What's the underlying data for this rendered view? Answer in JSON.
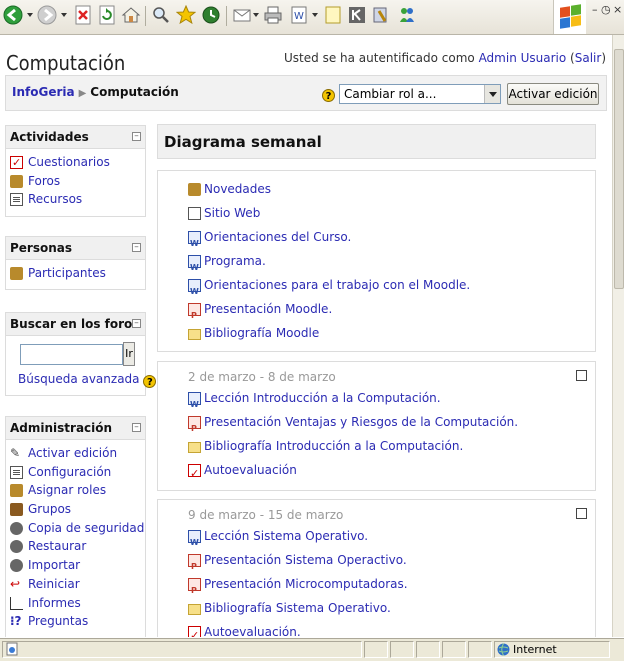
{
  "page": {
    "course_title": "Computación",
    "login_prefix": "Usted se ha autentificado como ",
    "login_user": "Admin Usuario",
    "login_logout": "Salir"
  },
  "navbar": {
    "home": "InfoGeria",
    "separator": "▶",
    "current": "Computación",
    "role_select_value": "Cambiar rol a...",
    "edit_button": "Activar edición"
  },
  "blocks": {
    "actividades": {
      "title": "Actividades",
      "items": [
        "Cuestionarios",
        "Foros",
        "Recursos"
      ]
    },
    "personas": {
      "title": "Personas",
      "items": [
        "Participantes"
      ]
    },
    "buscar": {
      "title": "Buscar en los foros",
      "go_button": "Ir",
      "advanced": "Búsqueda avanzada"
    },
    "administracion": {
      "title": "Administración",
      "items": [
        "Activar edición",
        "Configuración",
        "Asignar roles",
        "Grupos",
        "Copia de seguridad",
        "Restaurar",
        "Importar",
        "Reiniciar",
        "Informes",
        "Preguntas"
      ]
    }
  },
  "main": {
    "title": "Diagrama semanal",
    "section0": [
      "Novedades",
      "Sitio Web",
      "Orientaciones del Curso.",
      "Programa.",
      "Orientaciones para el trabajo con el Moodle.",
      "Presentación Moodle.",
      "Bibliografía Moodle"
    ],
    "week1": {
      "date": "2 de marzo - 8 de marzo",
      "items": [
        "Lección Introducción a la Computación.",
        "Presentación Ventajas y Riesgos de la Computación.",
        "Bibliografía Introducción a la Computación.",
        "Autoevaluación"
      ]
    },
    "week2": {
      "date": "9 de marzo - 15 de marzo",
      "items": [
        "Lección Sistema Operativo.",
        "Presentación Sistema Operactivo.",
        "Presentación Microcomputadoras.",
        "Bibliografía Sistema Operativo.",
        "Autoevaluación."
      ]
    }
  },
  "statusbar": {
    "zone": "Internet"
  }
}
